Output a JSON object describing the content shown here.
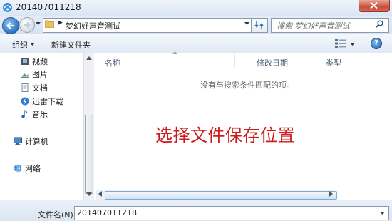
{
  "window": {
    "title": "201407011218"
  },
  "address": {
    "path": "梦幻好声音测试",
    "search_placeholder": "搜索 梦幻好声音测试"
  },
  "toolbar": {
    "organize": "组织",
    "new_folder": "新建文件夹"
  },
  "nav": {
    "items": [
      {
        "label": "视频",
        "icon": "video-icon"
      },
      {
        "label": "图片",
        "icon": "picture-icon"
      },
      {
        "label": "文档",
        "icon": "document-icon"
      },
      {
        "label": "迅雷下载",
        "icon": "thunder-download-icon"
      },
      {
        "label": "音乐",
        "icon": "music-icon"
      },
      {
        "label": "计算机",
        "icon": "computer-icon"
      },
      {
        "label": "网络",
        "icon": "network-icon"
      }
    ]
  },
  "columns": {
    "name": "名称",
    "modified": "修改日期",
    "type": "类型"
  },
  "content": {
    "empty_message": "没有与搜索条件匹配的项。"
  },
  "overlay": {
    "caption": "选择文件保存位置"
  },
  "filename": {
    "label": "文件名(N):",
    "value": "201407011218"
  },
  "colors": {
    "caption_red": "#cc1b1b",
    "accent_blue": "#2d73c2"
  }
}
